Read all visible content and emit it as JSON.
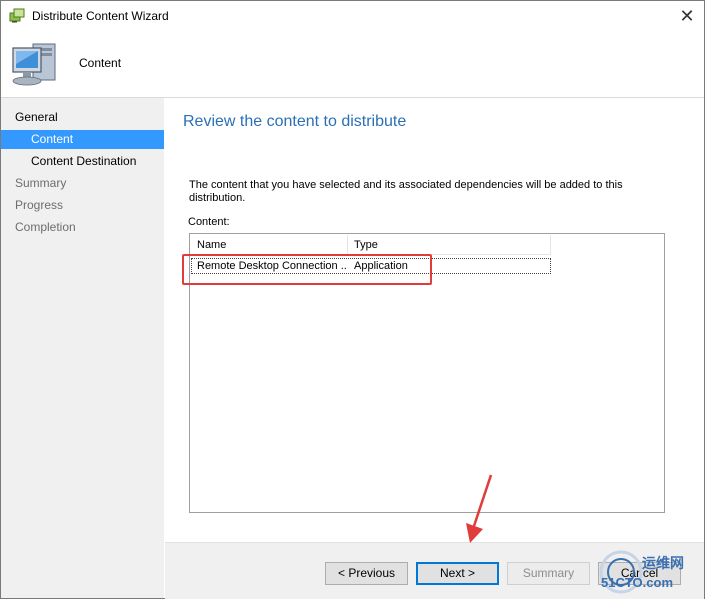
{
  "window": {
    "title": "Distribute Content Wizard",
    "close_glyph": "✕"
  },
  "header": {
    "text": "Content"
  },
  "nav": {
    "items": [
      {
        "label": "General",
        "level": "top",
        "state": "normal"
      },
      {
        "label": "Content",
        "level": "sub",
        "state": "selected"
      },
      {
        "label": "Content Destination",
        "level": "sub",
        "state": "normal"
      },
      {
        "label": "Summary",
        "level": "top",
        "state": "disabled"
      },
      {
        "label": "Progress",
        "level": "top",
        "state": "disabled"
      },
      {
        "label": "Completion",
        "level": "top",
        "state": "disabled"
      }
    ]
  },
  "main": {
    "title": "Review the content to distribute",
    "description": "The content that you have selected and its associated dependencies will be added to this distribution.",
    "content_label": "Content:",
    "columns": [
      "Name",
      "Type"
    ],
    "rows": [
      {
        "name": "Remote Desktop Connection ...",
        "type": "Application"
      }
    ]
  },
  "footer": {
    "previous_label": "< Previous",
    "next_label": "Next >",
    "summary_label": "Summary",
    "cancel_label": "Cancel"
  },
  "watermark": {
    "line1": "运维网",
    "line2": "51CTO.com"
  },
  "colors": {
    "accent": "#3399ff",
    "title_blue": "#2b6fb6",
    "annotation_red": "#e03c3c"
  },
  "icons": {
    "title": "wizard-app-icon",
    "header": "computer-monitor-icon",
    "close": "close-icon"
  }
}
